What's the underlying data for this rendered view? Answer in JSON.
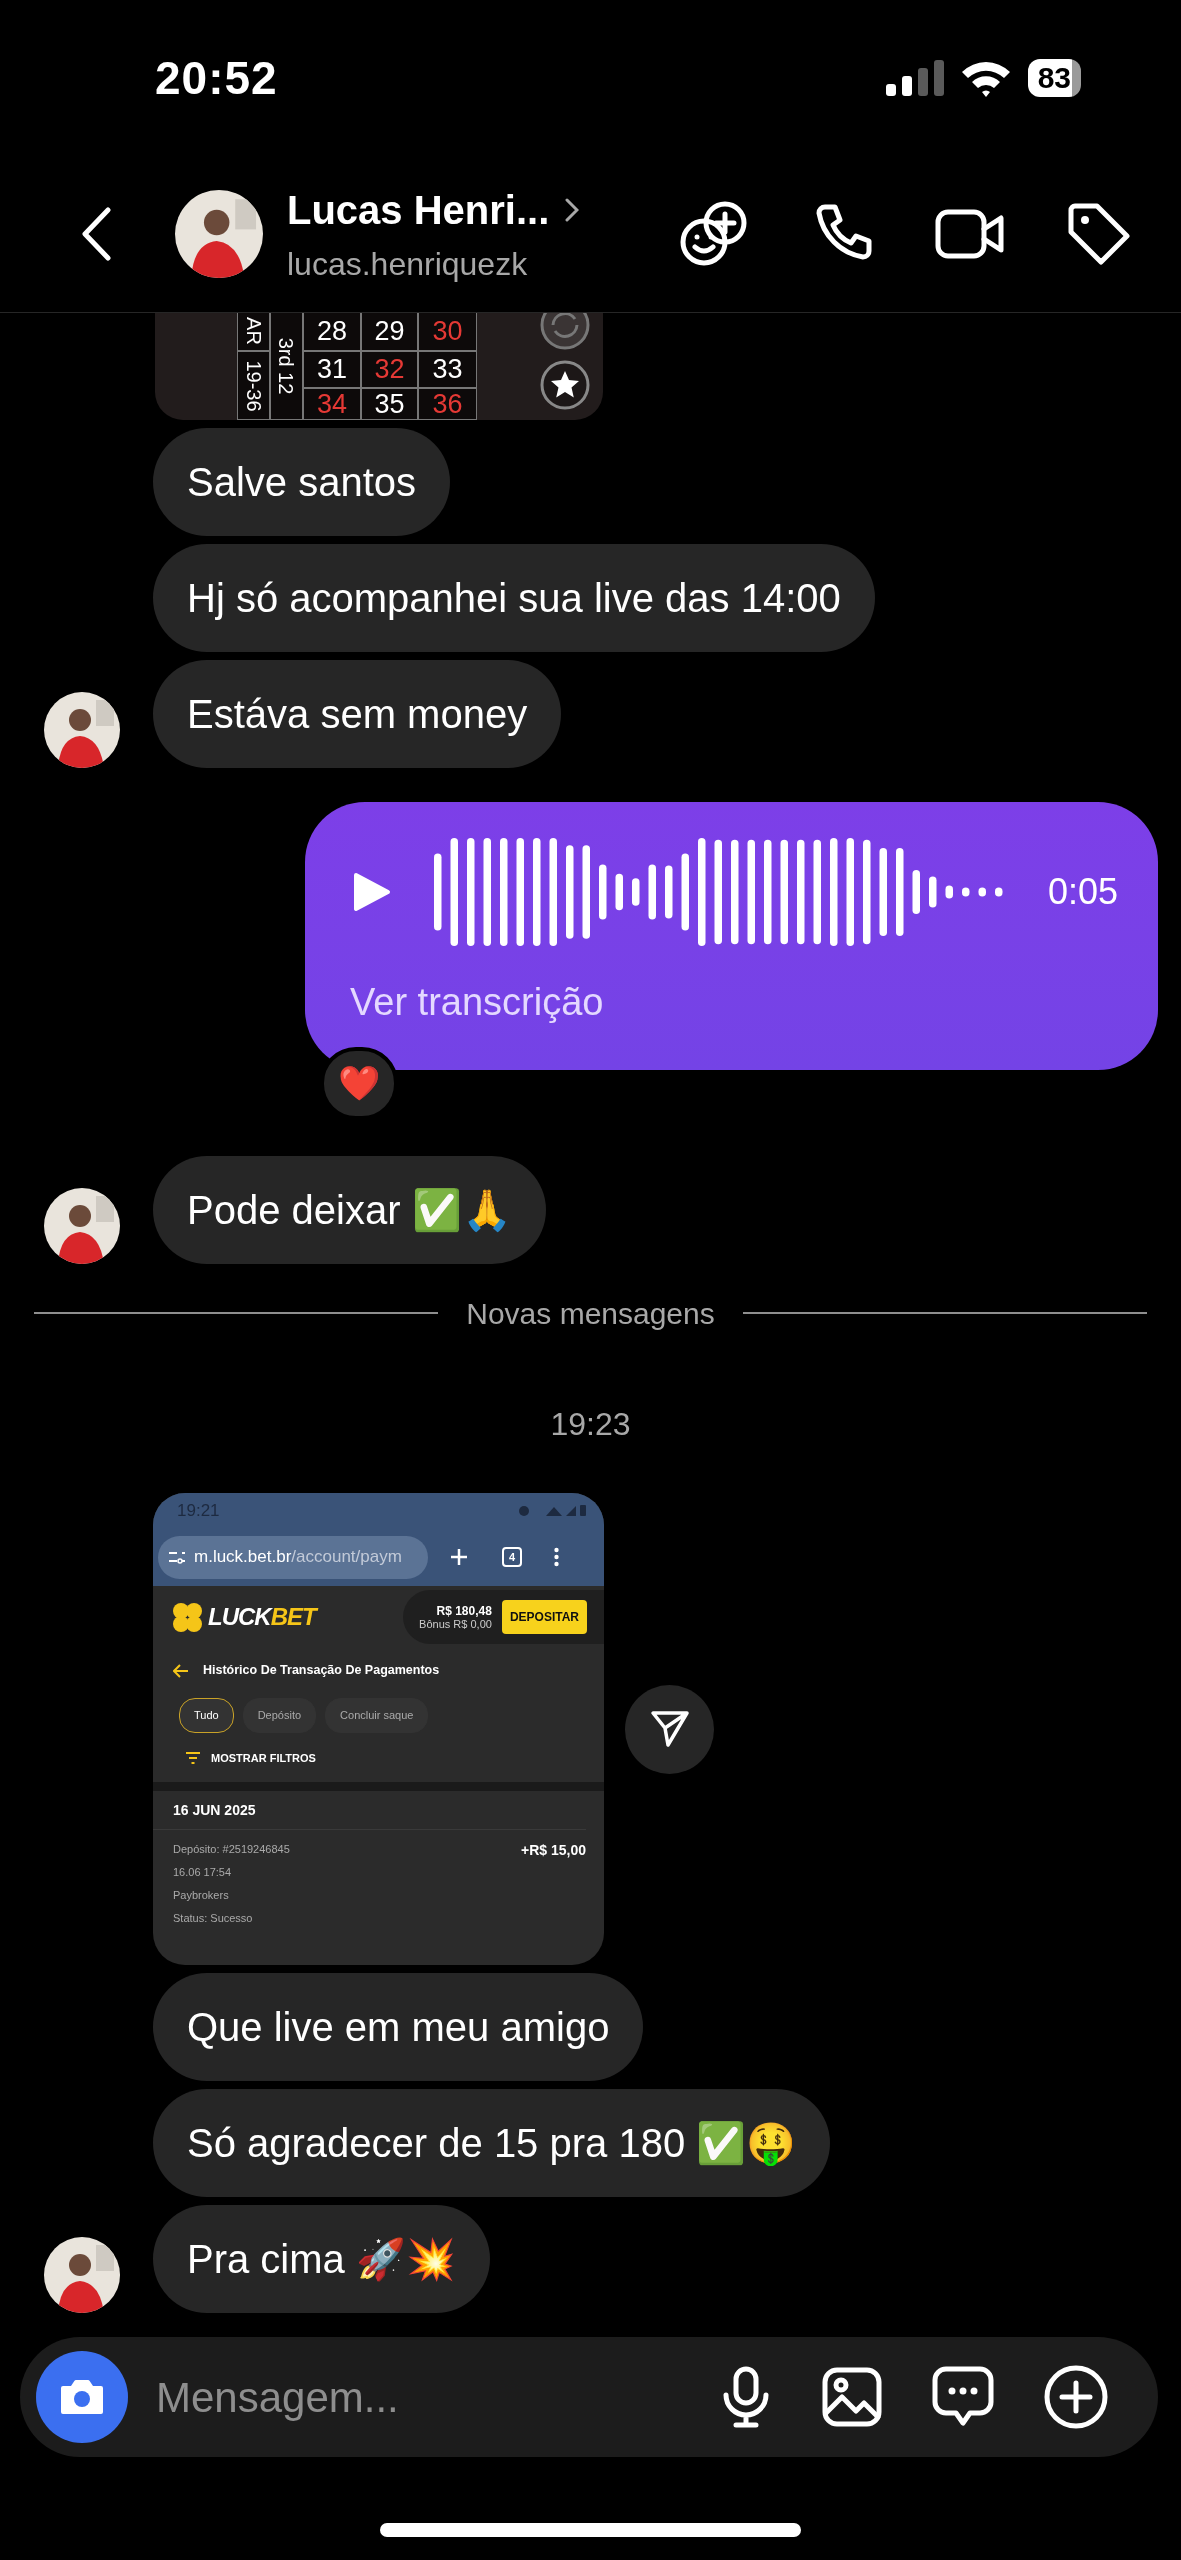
{
  "status_bar": {
    "time": "20:52",
    "battery": "83"
  },
  "header": {
    "name": "Lucas Henri...",
    "username": "lucas.henriquezk"
  },
  "messages": [
    {
      "kind": "roulette",
      "even_label": "AR",
      "range_label": "19-36",
      "dozen_label": "3rd 12",
      "cells": [
        {
          "text": "28",
          "color": "#ffffff"
        },
        {
          "text": "29",
          "color": "#ffffff"
        },
        {
          "text": "30",
          "color": "#e53935"
        },
        {
          "text": "31",
          "color": "#ffffff"
        },
        {
          "text": "32",
          "color": "#e53935"
        },
        {
          "text": "33",
          "color": "#ffffff"
        },
        {
          "text": "34",
          "color": "#e53935"
        },
        {
          "text": "35",
          "color": "#ffffff"
        },
        {
          "text": "36",
          "color": "#e53935"
        }
      ]
    },
    {
      "kind": "text",
      "text": "Salve santos",
      "avatar": false
    },
    {
      "kind": "text",
      "text": "Hj só acompanhei sua live das 14:00",
      "avatar": false
    },
    {
      "kind": "text",
      "text": "Estáva sem money",
      "avatar": true
    },
    {
      "kind": "voice",
      "duration": "0:05",
      "link": "Ver transcrição",
      "reaction": "❤️"
    },
    {
      "kind": "text",
      "text": "Pode deixar ✅🙏",
      "avatar": true
    },
    {
      "kind": "divider",
      "text": "Novas mensagens"
    },
    {
      "kind": "time",
      "text": "19:23"
    },
    {
      "kind": "screenshot",
      "phone_time": "19:21",
      "url_host": "m.luck.bet.br",
      "url_path": "/account/paym",
      "tab_count": "4",
      "logo_main": "LUCK",
      "logo_accent": "BET",
      "balance": "R$ 180,48",
      "bonus": "Bônus R$ 0,00",
      "deposit_button": "DEPOSITAR",
      "title": "Histórico De Transação De Pagamentos",
      "chips": [
        {
          "label": "Tudo",
          "selected": true
        },
        {
          "label": "Depósito",
          "selected": false
        },
        {
          "label": "Concluir saque",
          "selected": false
        }
      ],
      "filters": "MOSTRAR FILTROS",
      "date": "16 JUN 2025",
      "details": [
        "Depósito: #2519246845",
        "16.06 17:54",
        "Paybrokers",
        "Status: Sucesso"
      ],
      "amount": "+R$ 15,00"
    },
    {
      "kind": "text",
      "text": "Que live em meu amigo",
      "avatar": false
    },
    {
      "kind": "text",
      "text": "Só agradecer de 15 pra 180 ✅🤑",
      "avatar": false
    },
    {
      "kind": "text",
      "text": "Pra cima 🚀💥",
      "avatar": true
    }
  ],
  "composer": {
    "placeholder": "Mensagem..."
  }
}
